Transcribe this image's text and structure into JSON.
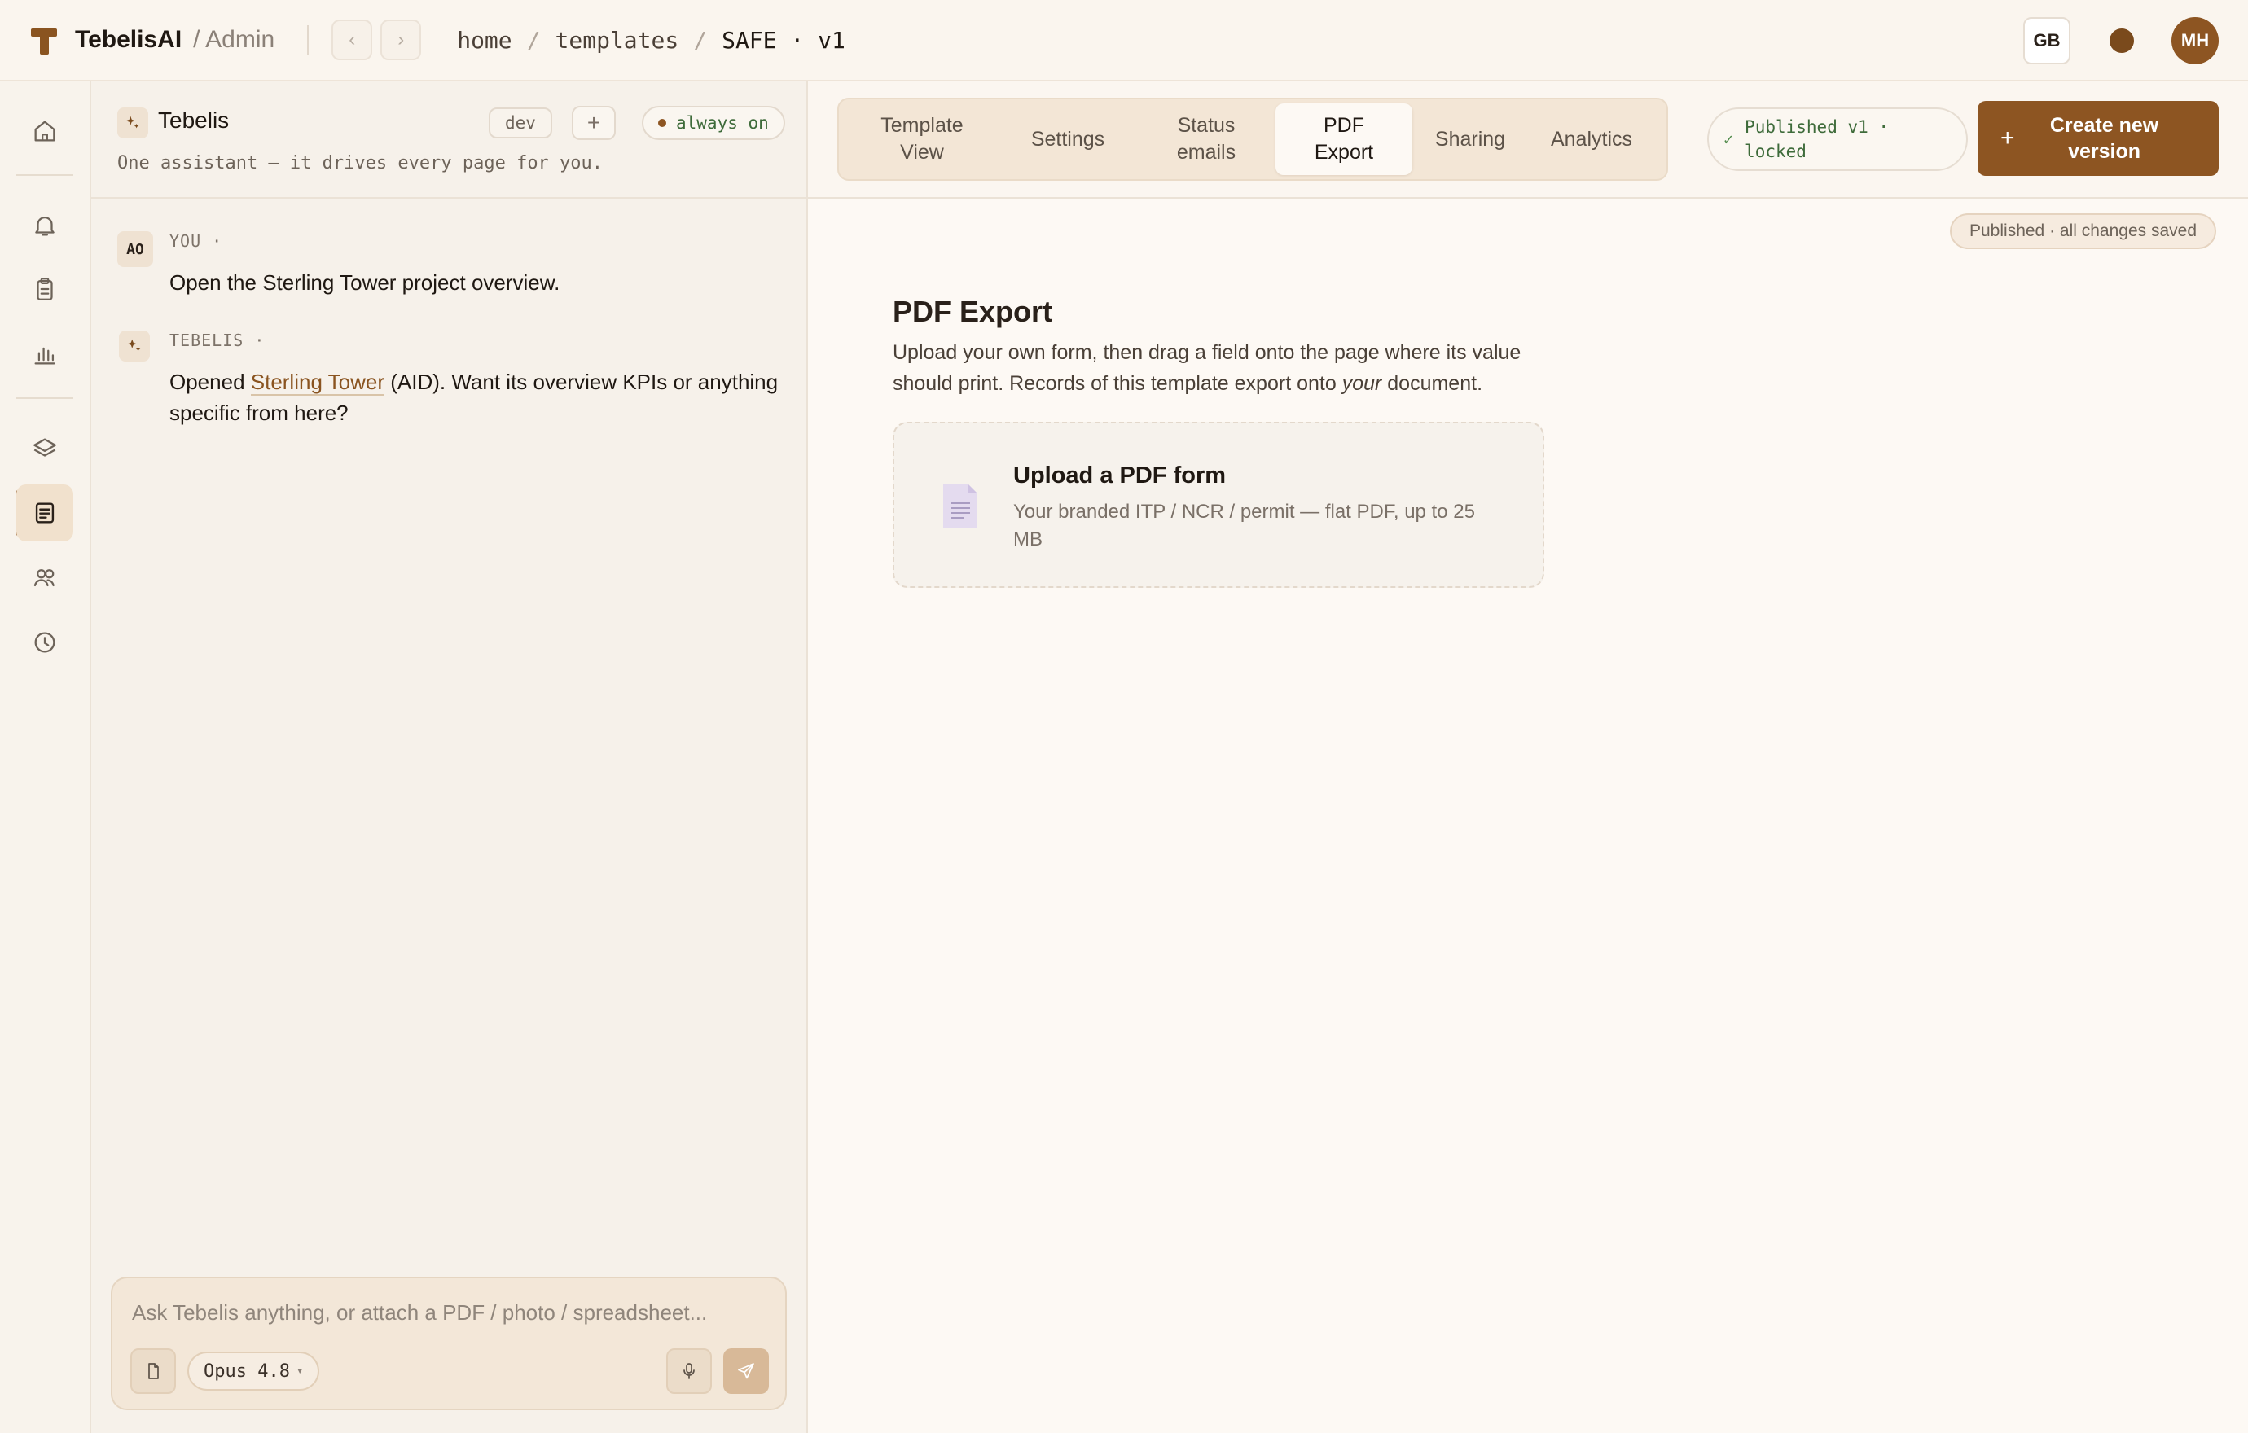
{
  "topbar": {
    "brand": "TebelisAI",
    "section": "/ Admin",
    "breadcrumbs": [
      "home",
      "templates",
      "SAFE · v1"
    ],
    "lang_button": "GB",
    "user_initials": "MH"
  },
  "rail": {
    "items": [
      "home-icon",
      "bell-icon",
      "clipboard-icon",
      "bar-chart-icon",
      "layers-icon",
      "document-icon",
      "users-icon",
      "clock-icon"
    ],
    "active": "document-icon"
  },
  "assistant": {
    "title": "Tebelis",
    "env_chip": "dev",
    "status_chip": "always on",
    "subtitle": "One assistant — it drives every page for you.",
    "messages": [
      {
        "badge": "AO",
        "who": "YOU ·",
        "text": "Open the Sterling Tower project overview."
      },
      {
        "who": "TEBELIS ·",
        "text_before": "Opened ",
        "link": "Sterling Tower",
        "text_after": " (AID). Want its overview KPIs or anything specific from here?"
      }
    ],
    "composer": {
      "placeholder": "Ask Tebelis anything, or attach a PDF / photo / spreadsheet...",
      "model": "Opus 4.8"
    }
  },
  "main": {
    "tabs": [
      {
        "label_lines": [
          "Template",
          "View"
        ]
      },
      {
        "label_lines": [
          "Settings"
        ]
      },
      {
        "label_lines": [
          "Status",
          "emails"
        ]
      },
      {
        "label_lines": [
          "PDF",
          "Export"
        ],
        "active": true
      },
      {
        "label_lines": [
          "Sharing"
        ]
      },
      {
        "label_lines": [
          "Analytics"
        ]
      }
    ],
    "published_chip_lines": [
      "Published v1 ·",
      "locked"
    ],
    "create_button_lines": [
      "Create new",
      "version"
    ],
    "saved_chip": "Published · all changes saved",
    "pdf_export": {
      "title": "PDF Export",
      "desc_before": "Upload your own form, then drag a field onto the page where its value should print. Records of this template export onto ",
      "desc_emph": "your",
      "desc_after": " document.",
      "upload_title": "Upload a PDF form",
      "upload_sub": "Your branded ITP / NCR / permit — flat PDF, up to 25 MB"
    }
  },
  "colors": {
    "accent": "#8d5522",
    "background": "#fdf9f4",
    "status_green": "#3e6b3a"
  }
}
